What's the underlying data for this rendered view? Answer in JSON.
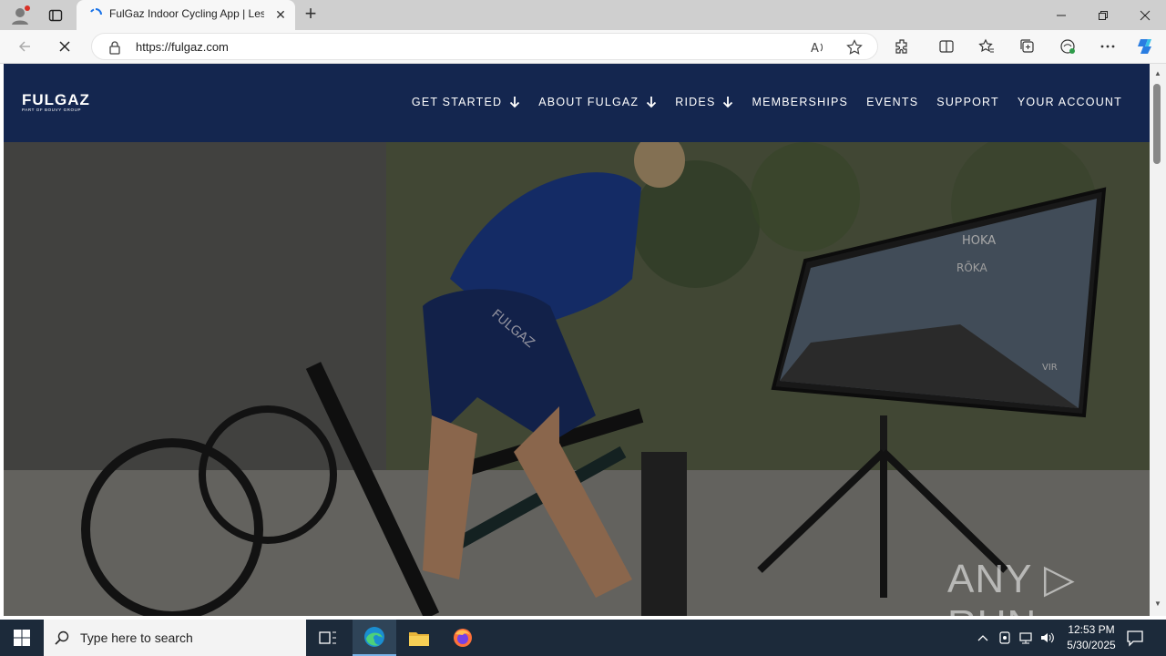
{
  "browser": {
    "tab_title": "FulGaz Indoor Cycling App | Less",
    "url": "https://fulgaz.com",
    "new_tab_symbol": "+",
    "tab_close_symbol": "✕"
  },
  "site": {
    "logo_word": "FULGAZ",
    "logo_sub": "PART OF BOUVY GROUP",
    "menu": [
      {
        "label": "GET STARTED",
        "has_dropdown": true
      },
      {
        "label": "ABOUT FULGAZ",
        "has_dropdown": true
      },
      {
        "label": "RIDES",
        "has_dropdown": true
      },
      {
        "label": "MEMBERSHIPS",
        "has_dropdown": false
      },
      {
        "label": "EVENTS",
        "has_dropdown": false
      },
      {
        "label": "SUPPORT",
        "has_dropdown": false
      },
      {
        "label": "YOUR ACCOUNT",
        "has_dropdown": false
      }
    ],
    "hero_screen_brands": [
      "HOKA",
      "RŌKA",
      "VIR"
    ],
    "hero_jersey_text": "FULGAZ"
  },
  "watermark": "ANY ▷ RUN",
  "taskbar": {
    "search_placeholder": "Type here to search",
    "time": "12:53 PM",
    "date": "5/30/2025"
  },
  "colors": {
    "site_header": "#14264f",
    "tabstrip": "#cfcfcf",
    "taskbar": "#1c2a3a"
  }
}
